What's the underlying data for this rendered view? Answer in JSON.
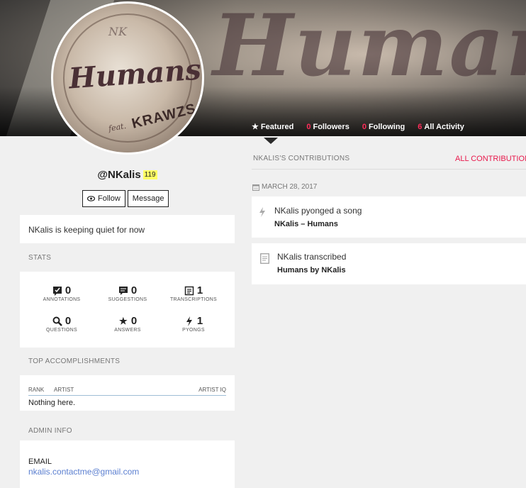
{
  "banner": {
    "word": "Humans"
  },
  "avatar": {
    "small": "NK",
    "title": "Humans",
    "sub": "KRAWZS",
    "feat": "feat."
  },
  "nav": [
    {
      "icon": "★",
      "count": "",
      "label": "Featured"
    },
    {
      "icon": "",
      "count": "0",
      "label": "Followers"
    },
    {
      "icon": "",
      "count": "0",
      "label": "Following"
    },
    {
      "icon": "",
      "count": "6",
      "label": "All Activity"
    }
  ],
  "profile": {
    "username": "@NKalis",
    "iq": "119",
    "follow_label": "Follow",
    "message_label": "Message",
    "bio": "NKalis is keeping quiet for now"
  },
  "stats": {
    "heading": "STATS",
    "items": [
      {
        "icon": "annotations-icon",
        "value": "0",
        "label": "ANNOTATIONS"
      },
      {
        "icon": "suggestions-icon",
        "value": "0",
        "label": "SUGGESTIONS"
      },
      {
        "icon": "transcriptions-icon",
        "value": "1",
        "label": "TRANSCRIPTIONS"
      },
      {
        "icon": "questions-icon",
        "value": "0",
        "label": "QUESTIONS"
      },
      {
        "icon": "answers-icon",
        "value": "0",
        "label": "ANSWERS"
      },
      {
        "icon": "pyongs-icon",
        "value": "1",
        "label": "PYONGS"
      }
    ]
  },
  "accomplishments": {
    "heading": "TOP ACCOMPLISHMENTS",
    "col_rank": "RANK",
    "col_artist": "ARTIST",
    "col_iq": "ARTIST IQ",
    "empty": "Nothing here."
  },
  "admin": {
    "heading": "ADMIN INFO",
    "email_label": "EMAIL",
    "email": "nkalis.contactme@gmail.com"
  },
  "contributions": {
    "heading": "NKALIS'S CONTRIBUTIONS",
    "all_link": "ALL CONTRIBUTIONS",
    "date": "MARCH 28, 2017",
    "items": [
      {
        "icon": "pyong-icon",
        "text": "NKalis pyonged a song",
        "subject": "NKalis – Humans"
      },
      {
        "icon": "transcription-icon",
        "text": "NKalis transcribed",
        "subject": "Humans by NKalis"
      }
    ]
  },
  "colors": {
    "accent": "#ff2d5a",
    "iq_badge": "#ffff64",
    "link": "#5b7fd0"
  }
}
